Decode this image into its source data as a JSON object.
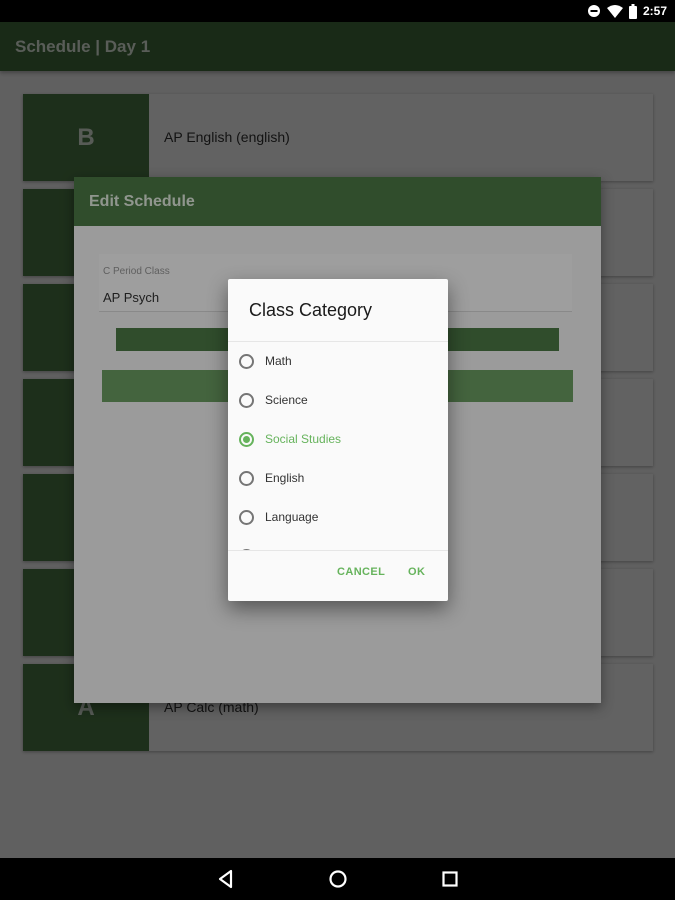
{
  "status_bar": {
    "time": "2:57",
    "icons": [
      "minus-circle-icon",
      "wifi-icon",
      "battery-icon"
    ]
  },
  "app_bar": {
    "title": "Schedule | Day 1"
  },
  "schedule": {
    "cards": [
      {
        "letter": "B",
        "text": "AP English (english)"
      },
      {
        "letter": "",
        "text": ""
      },
      {
        "letter": "",
        "text": ""
      },
      {
        "letter": "",
        "text": ""
      },
      {
        "letter": "",
        "text": ""
      },
      {
        "letter": "",
        "text": ""
      },
      {
        "letter": "A",
        "text": "AP Calc (math)"
      }
    ]
  },
  "edit_dialog": {
    "title": "Edit Schedule",
    "field_label": "C Period Class",
    "field_value": "AP Psych"
  },
  "category_dialog": {
    "title": "Class Category",
    "options": [
      {
        "label": "Math",
        "selected": false
      },
      {
        "label": "Science",
        "selected": false
      },
      {
        "label": "Social Studies",
        "selected": true
      },
      {
        "label": "English",
        "selected": false
      },
      {
        "label": "Language",
        "selected": false
      }
    ],
    "cancel_label": "CANCEL",
    "ok_label": "OK"
  },
  "nav_bar": {
    "icons": [
      "back-icon",
      "home-icon",
      "recents-icon"
    ]
  },
  "colors": {
    "primary": "#43703e",
    "primary_light": "#4e7d48",
    "accent": "#66b35c",
    "status_bar": "#000000"
  }
}
